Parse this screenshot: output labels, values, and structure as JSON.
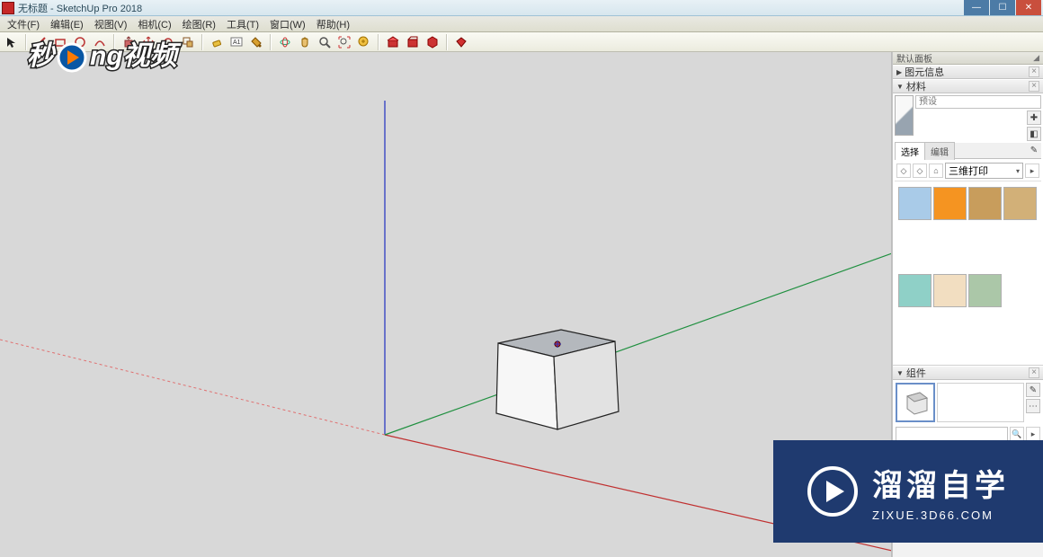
{
  "title": "无标题 - SketchUp Pro 2018",
  "menus": [
    "文件(F)",
    "编辑(E)",
    "视图(V)",
    "相机(C)",
    "绘图(R)",
    "工具(T)",
    "窗口(W)",
    "帮助(H)"
  ],
  "tray": {
    "title": "默认面板",
    "pin": "◢"
  },
  "panel_entity": {
    "label": "图元信息"
  },
  "panel_materials": {
    "label": "材料",
    "name_placeholder": "预设",
    "tab_select": "选择",
    "tab_edit": "编辑",
    "dropdown": "三维打印",
    "swatches": [
      "#a9cbe8",
      "#f59421",
      "#c89d5c",
      "#d2b078",
      "#8fd0c7",
      "#f2dec1",
      "#abc7a8"
    ]
  },
  "panel_components": {
    "label": "组件"
  },
  "watermark_left": "秒dong视频",
  "watermark_right": {
    "big": "溜溜自学",
    "sub": "ZIXUE.3D66.COM"
  },
  "toolbar_icons": [
    "select",
    "line",
    "rect",
    "circle",
    "arc",
    "eraser",
    "tape",
    "move",
    "rotate",
    "scale",
    "offset",
    "pushpull",
    "sep",
    "orbit",
    "pan",
    "zoom",
    "zoom-extents",
    "sep",
    "paint",
    "text",
    "dim",
    "sep",
    "section",
    "walk",
    "look",
    "sep",
    "layers",
    "outliner",
    "shadows",
    "styles",
    "sep",
    "warehouse",
    "extensions"
  ]
}
